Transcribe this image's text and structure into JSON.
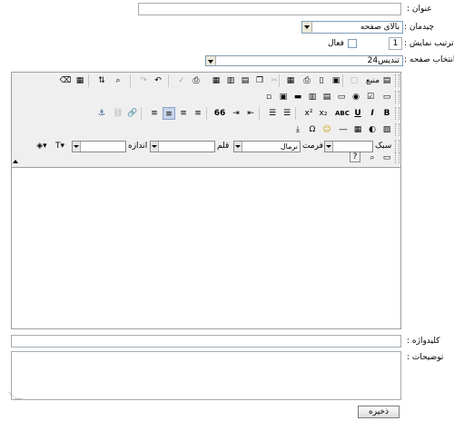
{
  "form": {
    "title_label": "عنوان :",
    "title_value": "",
    "layout_label": "چیدمان :",
    "layout_value": "بالای صفحه",
    "order_label": "ترتیب نمایش :",
    "order_value": "1",
    "active_label": "فعال",
    "page_label": "انتخاب صفحه :",
    "page_value": "تندیس24",
    "keywords_label": "کلیدواژه :",
    "keywords_value": "",
    "description_label": "توضیحات :",
    "description_value": "",
    "save_label": "ذخیره"
  },
  "editor": {
    "source_label": "منبع",
    "style_label": "سبک",
    "format_label": "فرمت",
    "format_value": "نرمال",
    "font_label": "قلم",
    "size_label": "اندازه",
    "superscript": "x²",
    "subscript": "x₂",
    "spell": "ABC",
    "underline": "U",
    "italic": "I",
    "bold": "B",
    "quote": "66"
  }
}
